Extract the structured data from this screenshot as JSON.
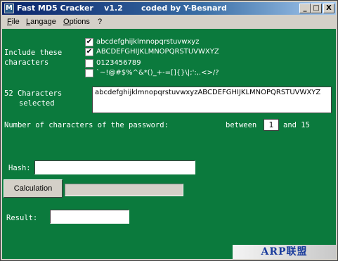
{
  "window": {
    "title": "Fast MD5 Cracker    v1.2",
    "byline": "coded by Y-Besnard",
    "controls": {
      "minimize": "_",
      "maximize": "□",
      "close": "X"
    }
  },
  "menu": {
    "file": "File",
    "language": "Langage",
    "options": "Options",
    "help": "?"
  },
  "include_label_line1": "Include these",
  "include_label_line2": "characters",
  "checkboxes": [
    {
      "label": "abcdefghijklmnopqrstuvwxyz",
      "checked": true
    },
    {
      "label": "ABCDEFGHIJKLMNOPQRSTUVWXYZ",
      "checked": true
    },
    {
      "label": "0123456789",
      "checked": false
    },
    {
      "label": "`~!@#$%^&*()_+-=[]{}\\|;':,.<>/?",
      "checked": false
    }
  ],
  "count_label_line1": "52 Characters",
  "count_label_line2": "selected",
  "charset_value": "abcdefghijklmnopqrstuvwxyzABCDEFGHIJKLMNOPQRSTUVWXYZ",
  "length_label": "Number of characters of the password:",
  "between_label": "between",
  "min_length": "1",
  "and_label": "and 15",
  "hash_label": "Hash:",
  "hash_value": "",
  "calc_button": "Calculation",
  "progress": 0,
  "result_label": "Result:",
  "result_value": "",
  "watermark": "ARP联盟",
  "colors": {
    "background": "#0b7a3d",
    "title_start": "#0a246a",
    "title_end": "#a6caf0"
  },
  "icons": {
    "checkbox_checked": "check-mark"
  }
}
